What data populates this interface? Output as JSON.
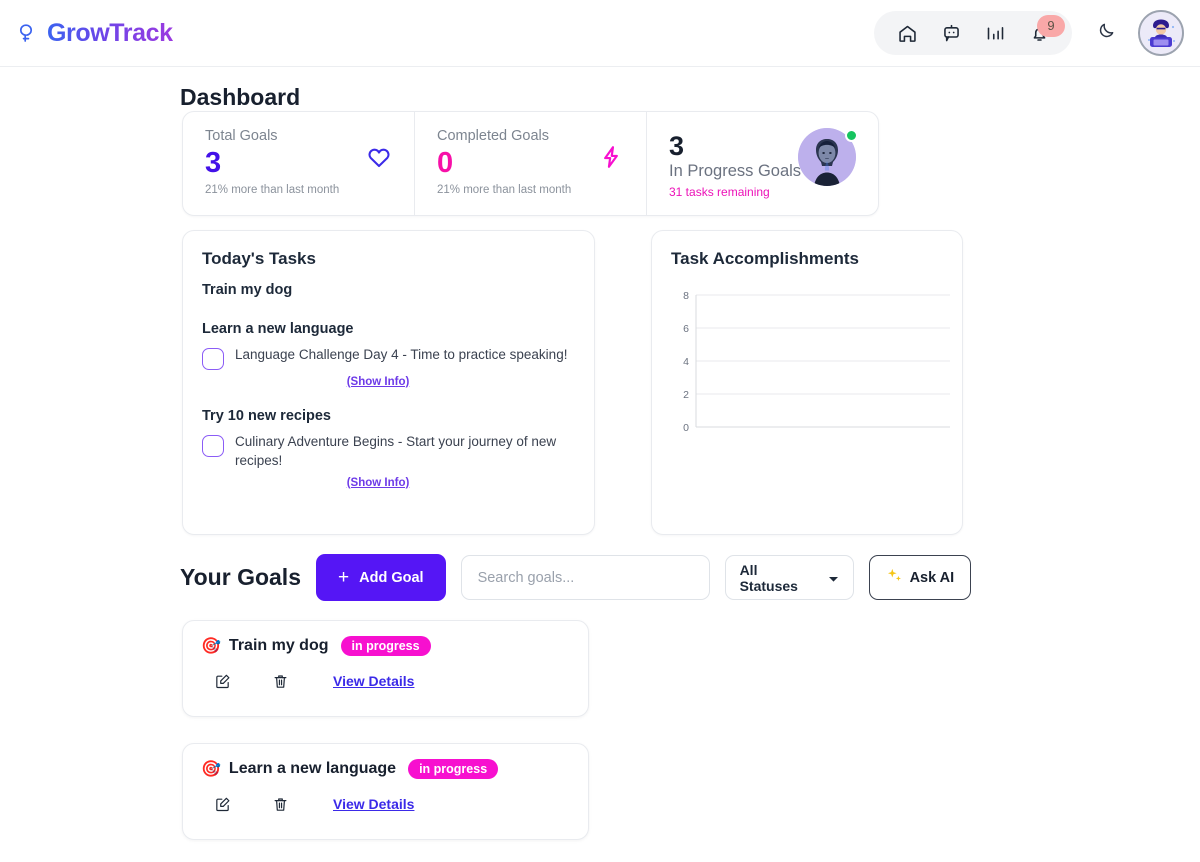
{
  "header": {
    "brand": "GrowTrack",
    "brand_icon": "tree-sprout-icon",
    "nav": [
      {
        "name": "home-icon",
        "label": "Home"
      },
      {
        "name": "chat-bot-icon",
        "label": "Chat"
      },
      {
        "name": "bar-chart-icon",
        "label": "Analytics"
      },
      {
        "name": "bell-icon",
        "label": "Notifications",
        "badge": "9"
      }
    ],
    "theme_toggle_icon": "moon-icon",
    "avatar_alt": "User avatar"
  },
  "page": {
    "title": "Dashboard"
  },
  "stats": [
    {
      "label": "Total Goals",
      "value": "3",
      "sub": "21% more than last month",
      "icon": "heart-icon",
      "value_color": "#4311e8",
      "icon_color": "#3b2ae8"
    },
    {
      "label": "Completed Goals",
      "value": "0",
      "sub": "21% more than last month",
      "icon": "lightning-bolt-icon",
      "value_color": "#f710a8",
      "icon_color": "#f710cf"
    },
    {
      "label": "In Progress Goals",
      "value": "3",
      "sub": "31 tasks remaining",
      "icon": "profile-photo-avatar",
      "value_color": "#18202e",
      "sub_color": "#ec12b8",
      "status": "online"
    }
  ],
  "tasks_panel": {
    "title": "Today's Tasks",
    "groups": [
      {
        "goal": "Train my dog",
        "items": []
      },
      {
        "goal": "Learn a new language",
        "items": [
          {
            "text": "Language Challenge Day 4 - Time to practice speaking!",
            "checked": false,
            "show_info": "(Show Info)"
          }
        ]
      },
      {
        "goal": "Try 10 new recipes",
        "items": [
          {
            "text": "Culinary Adventure Begins - Start your journey of new recipes!",
            "checked": false,
            "show_info": "(Show Info)"
          }
        ]
      }
    ]
  },
  "chart_panel": {
    "title": "Task Accomplishments"
  },
  "chart_data": {
    "type": "bar",
    "title": "Task Accomplishments",
    "categories": [],
    "values": [],
    "series": [],
    "xlabel": "",
    "ylabel": "",
    "yticks": [
      "0",
      "2",
      "4",
      "6",
      "8"
    ],
    "ylim": [
      0,
      8
    ],
    "grid": true,
    "legend": "none",
    "note": "empty plot area - no data series rendered"
  },
  "goals_toolbar": {
    "heading": "Your Goals",
    "add_goal_label": "Add Goal",
    "add_goal_plus": "+",
    "search_placeholder": "Search goals...",
    "search_value": "",
    "status_filter": "All Statuses",
    "ask_ai_label": "Ask AI",
    "ask_ai_icon": "sparkles-icon"
  },
  "goals": [
    {
      "emoji": "🎯",
      "name": "Train my dog",
      "status": "in progress",
      "edit_label": "Edit",
      "delete_label": "Delete",
      "details_label": "View Details"
    },
    {
      "emoji": "🎯",
      "name": "Learn a new language",
      "status": "in progress",
      "edit_label": "Edit",
      "delete_label": "Delete",
      "details_label": "View Details"
    }
  ],
  "colors": {
    "primary": "#5516f5",
    "accent_pink": "#f710cf",
    "link": "#3b2ae8",
    "badge_bg": "#f9a8a8",
    "online": "#16c45f"
  }
}
